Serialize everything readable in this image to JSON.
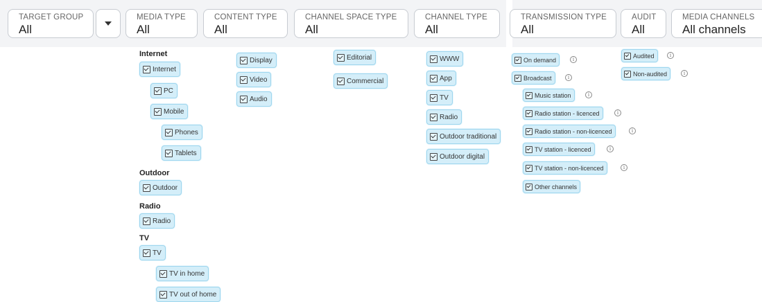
{
  "filters": [
    {
      "label": "TARGET GROUP",
      "value": "All"
    },
    {
      "label": "MEDIA TYPE",
      "value": "All"
    },
    {
      "label": "CONTENT TYPE",
      "value": "All"
    },
    {
      "label": "CHANNEL SPACE TYPE",
      "value": "All"
    },
    {
      "label": "CHANNEL TYPE",
      "value": "All"
    },
    {
      "label": "TRANSMISSION TYPE",
      "value": "All"
    },
    {
      "label": "AUDIT",
      "value": "All"
    },
    {
      "label": "MEDIA CHANNELS",
      "value": "All channels"
    }
  ],
  "icons": {
    "dropdown": "chevron-down-icon",
    "checkbox": "checkbox-checked-icon",
    "info": "info-icon"
  },
  "colors": {
    "chip_bg": "#d4eef9",
    "chip_border": "#9ed6ee",
    "topbar_bg": "#f3f4f6"
  },
  "media_type": {
    "groups": [
      {
        "heading": "Internet",
        "items": [
          "Internet",
          "PC",
          "Mobile",
          "Phones",
          "Tablets"
        ]
      },
      {
        "heading": "Outdoor",
        "items": [
          "Outdoor"
        ]
      },
      {
        "heading": "Radio",
        "items": [
          "Radio"
        ]
      },
      {
        "heading": "TV",
        "items": [
          "TV",
          "TV in home",
          "TV out of home"
        ]
      }
    ]
  },
  "content_type": {
    "items": [
      "Display",
      "Video",
      "Audio"
    ]
  },
  "channel_space_type": {
    "items": [
      "Editorial",
      "Commercial"
    ]
  },
  "channel_type": {
    "items": [
      "WWW",
      "App",
      "TV",
      "Radio",
      "Outdoor traditional",
      "Outdoor digital"
    ]
  },
  "transmission_type": {
    "items": [
      "On demand",
      "Broadcast",
      "Music station",
      "Radio station - licenced",
      "Radio station - non-licenced",
      "TV station - licenced",
      "TV station - non-licenced",
      "Other channels"
    ]
  },
  "audit": {
    "items": [
      "Audited",
      "Non-audited"
    ]
  },
  "info_glyph": "i"
}
